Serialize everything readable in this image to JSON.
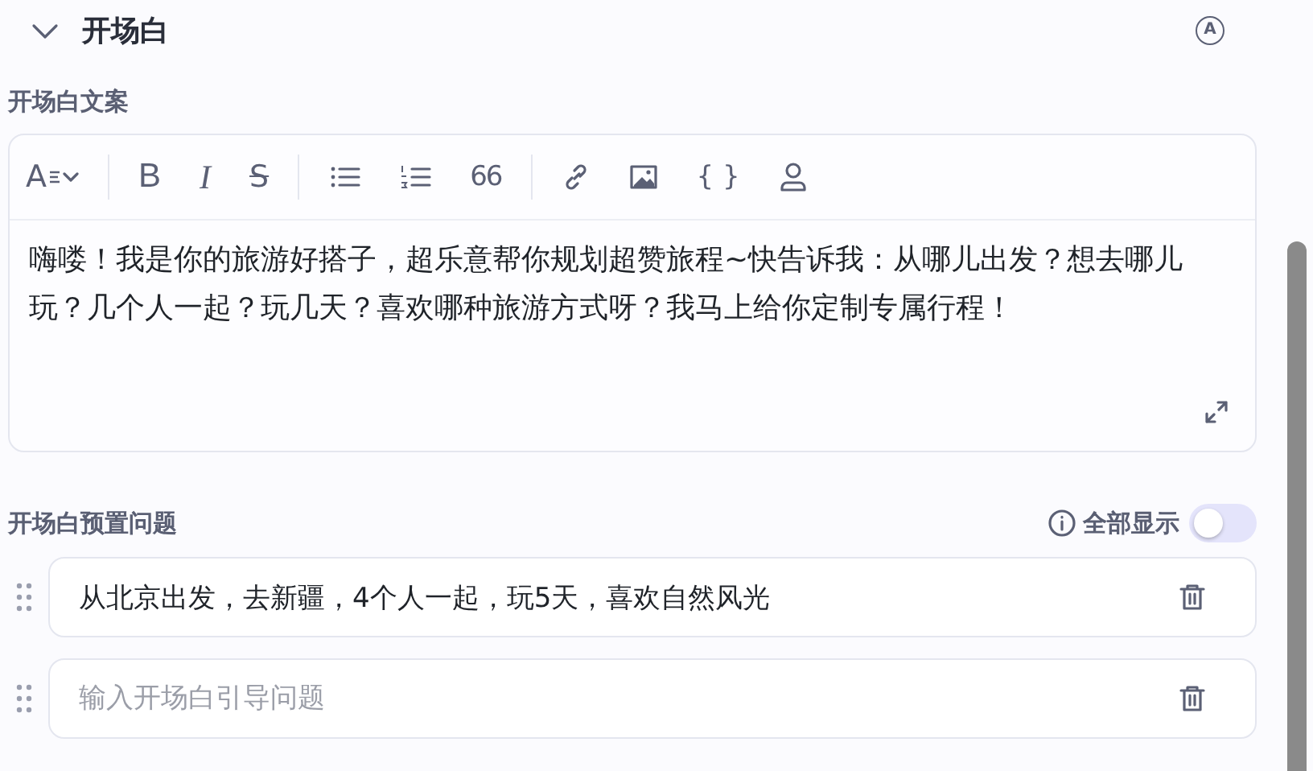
{
  "section": {
    "title": "开场白",
    "expanded": true,
    "badge": "A"
  },
  "editor": {
    "label": "开场白文案",
    "toolbar": [
      [
        {
          "kind": "font",
          "label": "A"
        }
      ],
      [
        {
          "kind": "bold",
          "label": "B"
        },
        {
          "kind": "italic",
          "label": "I"
        },
        {
          "kind": "strike",
          "label": "S"
        }
      ],
      [
        {
          "kind": "bullets"
        },
        {
          "kind": "numbers"
        },
        {
          "kind": "quote",
          "label": "66"
        }
      ],
      [
        {
          "kind": "link"
        },
        {
          "kind": "image"
        },
        {
          "kind": "code",
          "label": "{ }"
        },
        {
          "kind": "mention"
        }
      ]
    ],
    "value": "嗨喽！我是你的旅游好搭子，超乐意帮你规划超赞旅程~快告诉我：从哪儿出发？想去哪儿玩？几个人一起？玩几天？喜欢哪种旅游方式呀？我马上给你定制专属行程！"
  },
  "questions": {
    "label": "开场白预置问题",
    "show_all": {
      "label": "全部显示",
      "on": false
    },
    "items": [
      {
        "value": "从北京出发，去新疆，4个人一起，玩5天，喜欢自然风光"
      },
      {
        "placeholder": "输入开场白引导问题"
      }
    ]
  }
}
